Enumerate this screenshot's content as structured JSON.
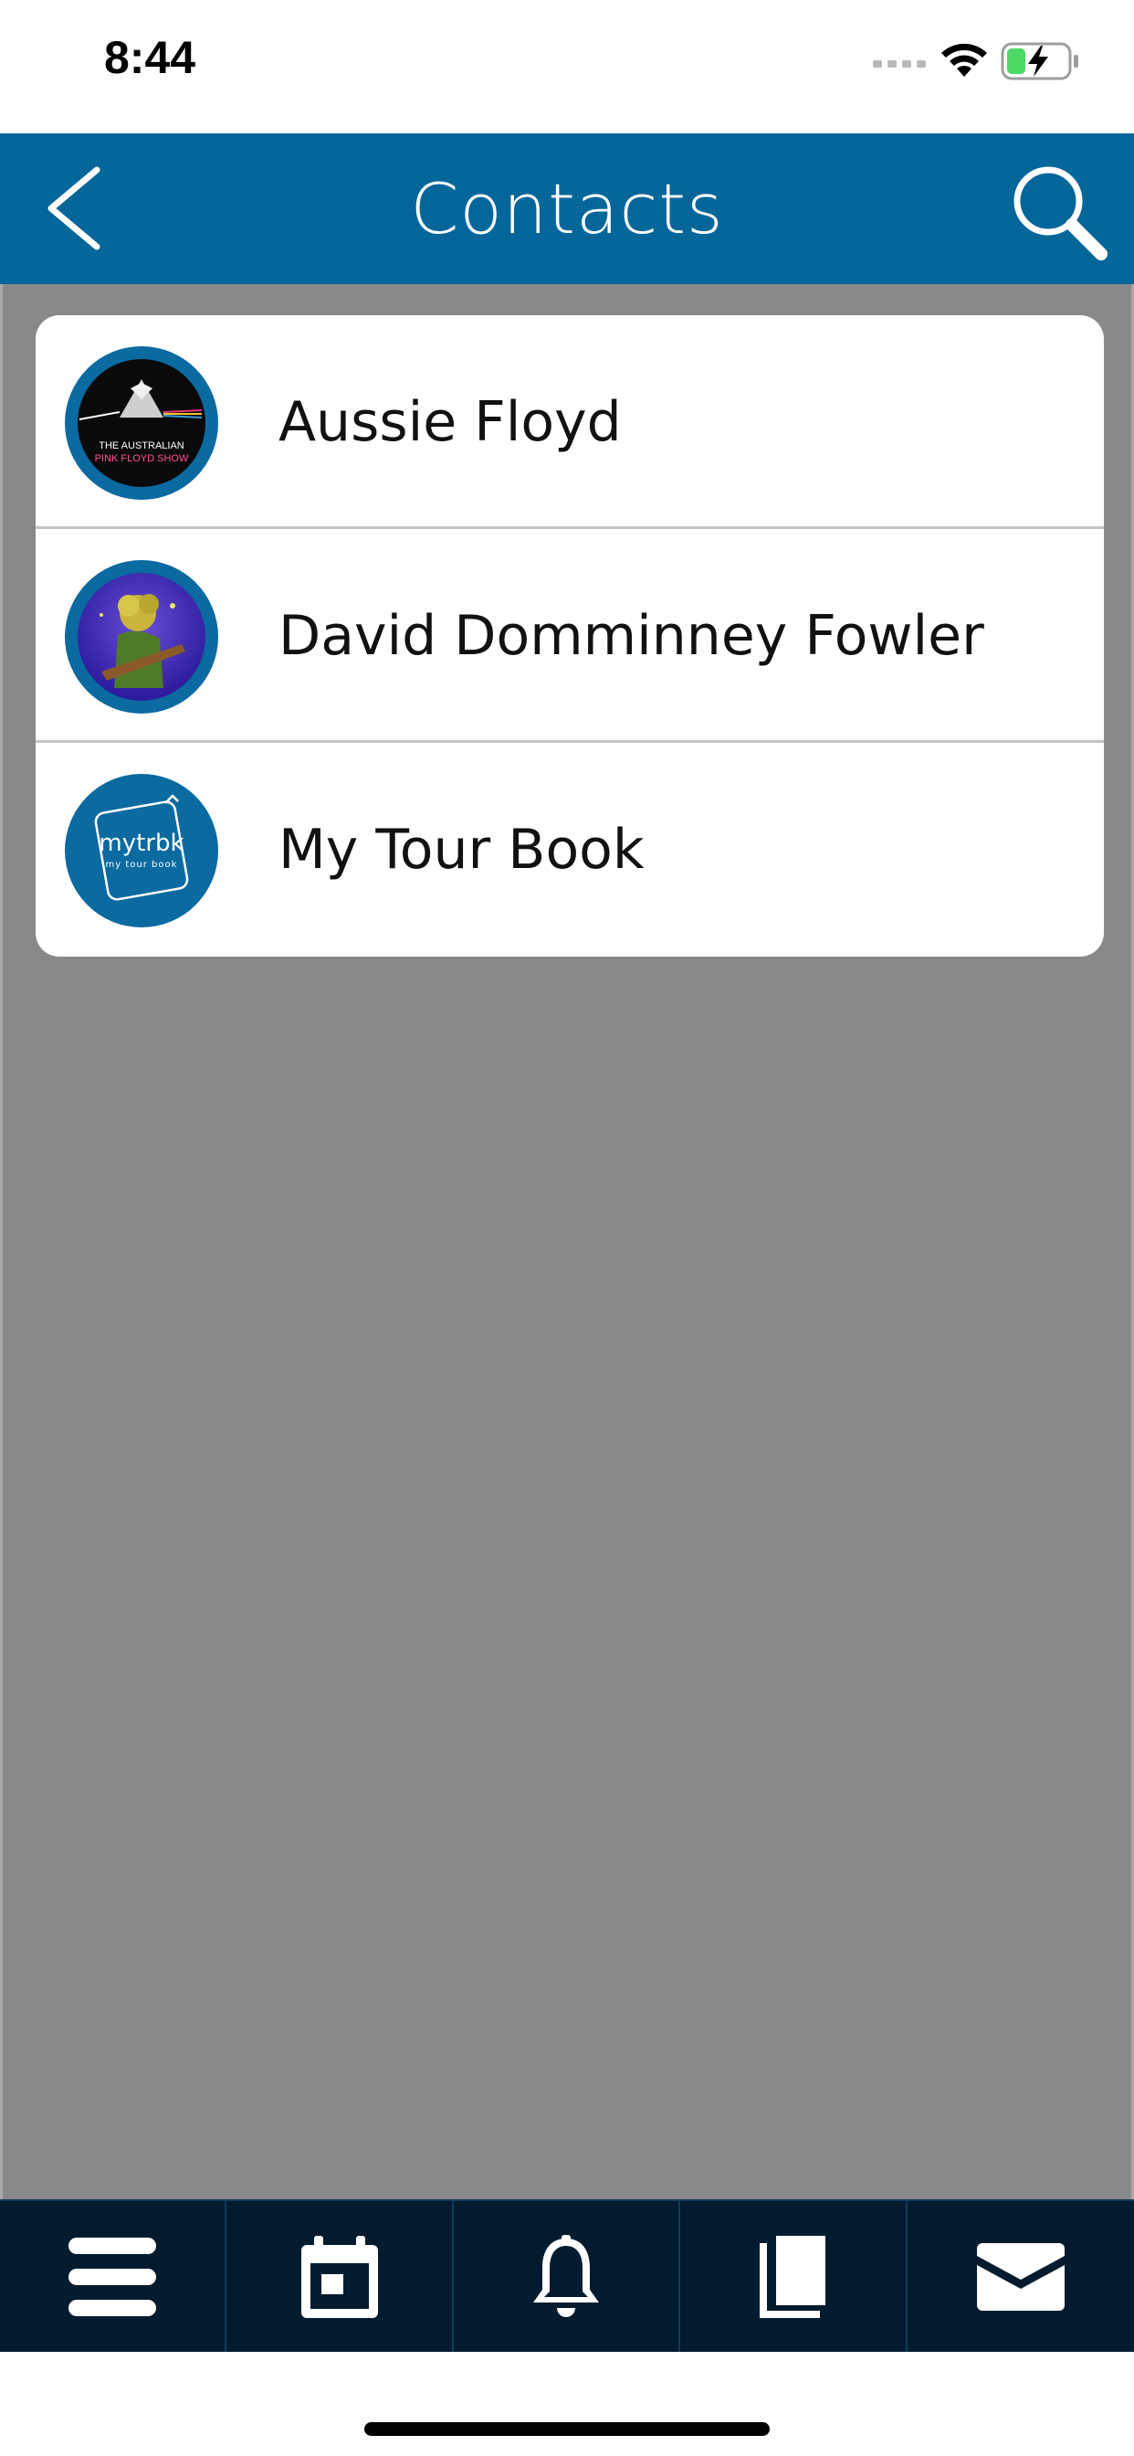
{
  "status_bar": {
    "time": "8:44"
  },
  "nav": {
    "title": "Contacts"
  },
  "contacts": [
    {
      "name": "Aussie Floyd",
      "avatar_text_line1": "THE AUSTRALIAN",
      "avatar_text_line2": "PINK FLOYD SHOW"
    },
    {
      "name": "David Domminney Fowler"
    },
    {
      "name": "My Tour Book",
      "avatar_text_line1": "mytrbk",
      "avatar_text_line2": "my tour book"
    }
  ],
  "tabs": [
    {
      "icon": "menu-icon"
    },
    {
      "icon": "calendar-icon"
    },
    {
      "icon": "bell-icon"
    },
    {
      "icon": "book-icon"
    },
    {
      "icon": "mail-icon"
    }
  ],
  "colors": {
    "nav": "#05669a",
    "content_bg": "#898989",
    "tab_bar": "#021b2e",
    "avatar_ring": "#0b6aa0"
  }
}
